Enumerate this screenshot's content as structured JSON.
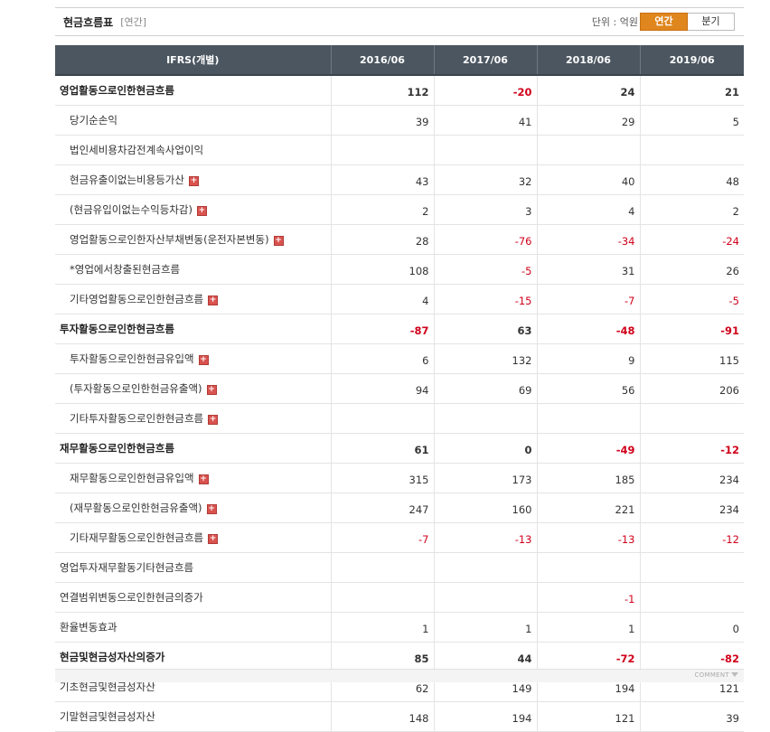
{
  "header": {
    "title": "현금흐름표",
    "period_tag": "[연간]",
    "unit": "단위 : 억원",
    "toggle": {
      "annual": "연간",
      "quarterly": "분기"
    }
  },
  "table": {
    "columns": [
      "IFRS(개별)",
      "2016/06",
      "2017/06",
      "2018/06",
      "2019/06"
    ],
    "rows": [
      {
        "label": "영업활동으로인한현금흐름",
        "level": "main",
        "expand": false,
        "values": [
          "112",
          "-20",
          "24",
          "21"
        ]
      },
      {
        "label": "당기순손익",
        "level": "sub",
        "expand": false,
        "values": [
          "39",
          "41",
          "29",
          "5"
        ]
      },
      {
        "label": "법인세비용차감전계속사업이익",
        "level": "sub",
        "expand": false,
        "values": [
          "",
          "",
          "",
          ""
        ]
      },
      {
        "label": "현금유출이없는비용등가산",
        "level": "sub",
        "expand": true,
        "values": [
          "43",
          "32",
          "40",
          "48"
        ]
      },
      {
        "label": "(현금유입이없는수익등차감)",
        "level": "sub",
        "expand": true,
        "values": [
          "2",
          "3",
          "4",
          "2"
        ]
      },
      {
        "label": "영업활동으로인한자산부채변동(운전자본변동)",
        "level": "sub",
        "expand": true,
        "values": [
          "28",
          "-76",
          "-34",
          "-24"
        ]
      },
      {
        "label": "*영업에서창출된현금흐름",
        "level": "sub",
        "expand": false,
        "values": [
          "108",
          "-5",
          "31",
          "26"
        ]
      },
      {
        "label": "기타영업활동으로인한현금흐름",
        "level": "sub",
        "expand": true,
        "values": [
          "4",
          "-15",
          "-7",
          "-5"
        ]
      },
      {
        "label": "투자활동으로인한현금흐름",
        "level": "main",
        "expand": false,
        "values": [
          "-87",
          "63",
          "-48",
          "-91"
        ]
      },
      {
        "label": "투자활동으로인한현금유입액",
        "level": "sub",
        "expand": true,
        "values": [
          "6",
          "132",
          "9",
          "115"
        ]
      },
      {
        "label": "(투자활동으로인한현금유출액)",
        "level": "sub",
        "expand": true,
        "values": [
          "94",
          "69",
          "56",
          "206"
        ]
      },
      {
        "label": "기타투자활동으로인한현금흐름",
        "level": "sub",
        "expand": true,
        "values": [
          "",
          "",
          "",
          ""
        ]
      },
      {
        "label": "재무활동으로인한현금흐름",
        "level": "main",
        "expand": false,
        "values": [
          "61",
          "0",
          "-49",
          "-12"
        ]
      },
      {
        "label": "재무활동으로인한현금유입액",
        "level": "sub",
        "expand": true,
        "values": [
          "315",
          "173",
          "185",
          "234"
        ]
      },
      {
        "label": "(재무활동으로인한현금유출액)",
        "level": "sub",
        "expand": true,
        "values": [
          "247",
          "160",
          "221",
          "234"
        ]
      },
      {
        "label": "기타재무활동으로인한현금흐름",
        "level": "sub",
        "expand": true,
        "values": [
          "-7",
          "-13",
          "-13",
          "-12"
        ]
      },
      {
        "label": "영업투자재무활동기타현금흐름",
        "level": "top",
        "expand": false,
        "values": [
          "",
          "",
          "",
          ""
        ]
      },
      {
        "label": "연결범위변동으로인한현금의증가",
        "level": "top",
        "expand": false,
        "values": [
          "",
          "",
          "-1",
          ""
        ]
      },
      {
        "label": "환율변동효과",
        "level": "top",
        "expand": false,
        "values": [
          "1",
          "1",
          "1",
          "0"
        ]
      },
      {
        "label": "현금및현금성자산의증가",
        "level": "main",
        "expand": false,
        "values": [
          "85",
          "44",
          "-72",
          "-82"
        ]
      },
      {
        "label": "기초현금및현금성자산",
        "level": "top",
        "expand": false,
        "values": [
          "62",
          "149",
          "194",
          "121"
        ]
      },
      {
        "label": "기말현금및현금성자산",
        "level": "top",
        "expand": false,
        "values": [
          "148",
          "194",
          "121",
          "39"
        ]
      }
    ]
  },
  "footer": {
    "comment": "COMMENT"
  },
  "colors": {
    "header_bg": "#4b5660",
    "toggle_active": "#e0861e",
    "negative": "#d0021b",
    "expand_icon": "#d9534f"
  },
  "icons": {
    "expand": "plus-icon",
    "comment_toggle": "chevron-down-icon"
  }
}
